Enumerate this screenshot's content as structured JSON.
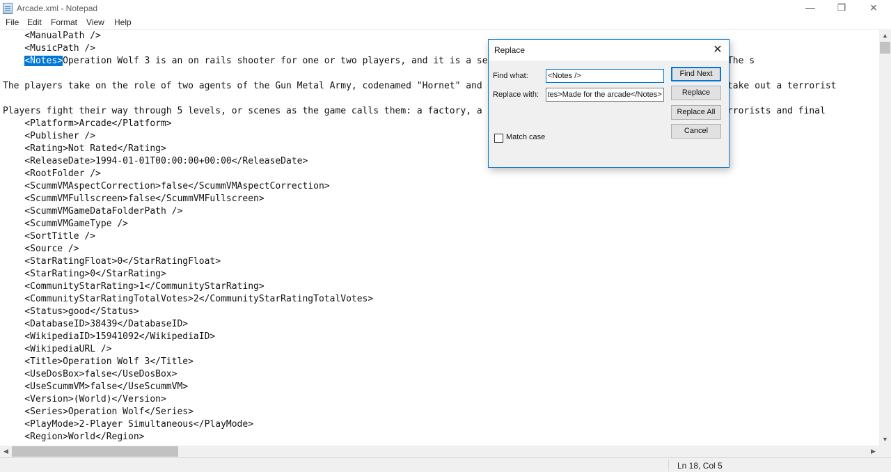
{
  "window": {
    "title": "Arcade.xml - Notepad",
    "minimize_glyph": "—",
    "restore_glyph": "❐",
    "close_glyph": "✕"
  },
  "menu": {
    "items": [
      "File",
      "Edit",
      "Format",
      "View",
      "Help"
    ]
  },
  "editor": {
    "lines": [
      "    <ManualPath />",
      "    <MusicPath />",
      "Operation Wolf 3 is an on rails shooter for one or two players, and it is a sequel to Operation Thunderbolt only in name. The s",
      "",
      "The players take on the role of two agents of the Gun Metal Army, codenamed \"Hornet\" and \"Sheriff\", who must infiltrate an island to take out a terrorist",
      "",
      "Players fight their way through 5 levels, or scenes as the game calls them: a factory, a research institute, a ship, the HQ of the terrorists and final",
      "    <Platform>Arcade</Platform>",
      "    <Publisher />",
      "    <Rating>Not Rated</Rating>",
      "    <ReleaseDate>1994-01-01T00:00:00+00:00</ReleaseDate>",
      "    <RootFolder />",
      "    <ScummVMAspectCorrection>false</ScummVMAspectCorrection>",
      "    <ScummVMFullscreen>false</ScummVMFullscreen>",
      "    <ScummVMGameDataFolderPath />",
      "    <ScummVMGameType />",
      "    <SortTitle />",
      "    <Source />",
      "    <StarRatingFloat>0</StarRatingFloat>",
      "    <StarRating>0</StarRating>",
      "    <CommunityStarRating>1</CommunityStarRating>",
      "    <CommunityStarRatingTotalVotes>2</CommunityStarRatingTotalVotes>",
      "    <Status>good</Status>",
      "    <DatabaseID>38439</DatabaseID>",
      "    <WikipediaID>15941092</WikipediaID>",
      "    <WikipediaURL />",
      "    <Title>Operation Wolf 3</Title>",
      "    <UseDosBox>false</UseDosBox>",
      "    <UseScummVM>false</UseScummVM>",
      "    <Version>(World)</Version>",
      "    <Series>Operation Wolf</Series>",
      "    <PlayMode>2-Player Simultaneous</PlayMode>",
      "    <Region>World</Region>"
    ],
    "line_prefix": "    ",
    "selected_text": "<Notes>"
  },
  "status": {
    "position": "Ln 18, Col 5"
  },
  "replace_dialog": {
    "title": "Replace",
    "find_label": "Find what:",
    "find_value": "<Notes />",
    "replace_label": "Replace with:",
    "replace_value": "<Notes>Made for the arcade</Notes>",
    "match_case_label": "Match case",
    "match_case_checked": false,
    "buttons": {
      "find_next": "Find Next",
      "replace": "Replace",
      "replace_all": "Replace All",
      "cancel": "Cancel"
    },
    "close_glyph": "✕"
  },
  "scroll": {
    "up": "▲",
    "down": "▼",
    "left": "◀",
    "right": "▶"
  },
  "colors": {
    "selection": "#0078d7",
    "dialog_border": "#0078d7"
  }
}
